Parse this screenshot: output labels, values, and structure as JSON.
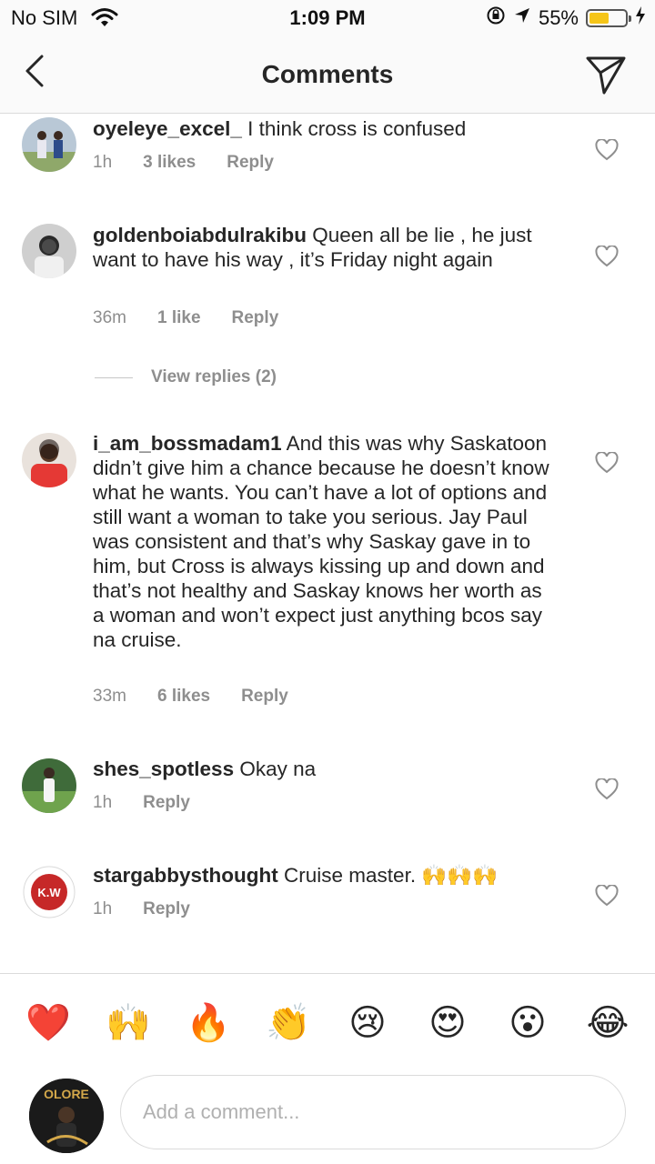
{
  "status_bar": {
    "carrier": "No SIM",
    "time": "1:09 PM",
    "battery_percent": "55%",
    "battery_level": 0.55
  },
  "header": {
    "title": "Comments"
  },
  "comments": [
    {
      "username": "oyeleye_excel_",
      "text": "I think cross is confused",
      "age": "1h",
      "likes": "3 likes",
      "reply": "Reply"
    },
    {
      "username": "goldenboiabdulrakibu",
      "text": "Queen all be lie , he just want to have his way , it’s Friday night again",
      "age": "36m",
      "likes": "1 like",
      "reply": "Reply"
    },
    {
      "username": "i_am_bossmadam1",
      "text": "And this was why Saskatoon didn’t give him a chance because he doesn’t know what he wants. You can’t have a lot of options and still want a woman to take you serious. Jay Paul was consistent and that’s why Saskay gave in to him, but Cross is always kissing up and down and that’s not healthy and Saskay knows her worth as a woman and won’t expect just anything bcos say na cruise.",
      "age": "33m",
      "likes": "6 likes",
      "reply": "Reply"
    },
    {
      "username": "shes_spotless",
      "text": "Okay na",
      "age": "1h",
      "likes": "",
      "reply": "Reply"
    },
    {
      "username": "stargabbysthought",
      "text": "Cruise master. 🙌🙌🙌",
      "age": "1h",
      "likes": "",
      "reply": "Reply",
      "avatar_text": "K.W"
    }
  ],
  "view_replies": "View replies (2)",
  "emoji_bar": [
    "❤️",
    "🙌",
    "🔥",
    "👏",
    "😢",
    "😍",
    "😮",
    "😂"
  ],
  "input": {
    "placeholder": "Add a comment..."
  },
  "my_avatar": {
    "text": "OLORE"
  },
  "colors": {
    "text": "#262626",
    "meta": "#8e8e8e",
    "divider": "#dbdbdb",
    "battery": "#f5c518"
  }
}
